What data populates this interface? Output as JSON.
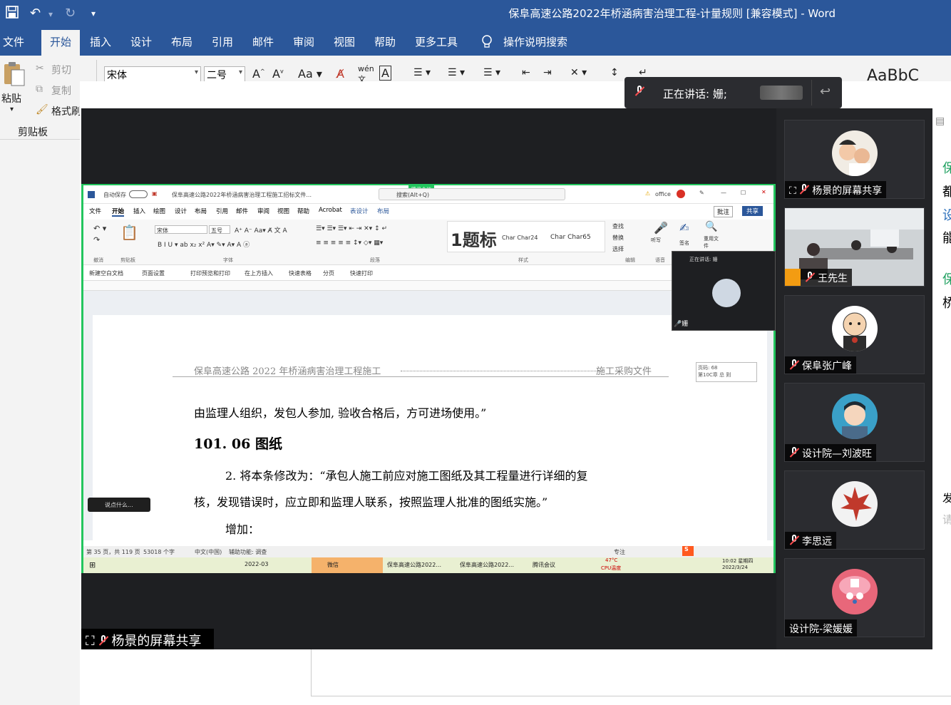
{
  "word": {
    "title": "保阜高速公路2022年桥涵病害治理工程-计量规则 [兼容模式]  -  Word",
    "tabs": [
      "文件",
      "开始",
      "插入",
      "设计",
      "布局",
      "引用",
      "邮件",
      "审阅",
      "视图",
      "帮助",
      "更多工具"
    ],
    "active_tab": "开始",
    "search_label": "操作说明搜索",
    "clipboard": {
      "paste": "粘贴",
      "cut": "剪切",
      "copy": "复制",
      "format_painter": "格式刷",
      "group": "剪贴板"
    },
    "font_name": "宋体",
    "font_size": "二号",
    "style_preview": "AaBbC",
    "right_edge_text": [
      "保",
      "都",
      "设",
      "能",
      "保",
      "桥",
      "发",
      "请"
    ]
  },
  "meeting": {
    "speaking_label": "正在讲话: 姗;",
    "share_label": "杨景的屏幕共享",
    "participants": [
      {
        "name": "杨景的屏幕共享",
        "avatar": "baby-photo-avatar"
      },
      {
        "name": "王先生",
        "avatar": "meeting-room-video"
      },
      {
        "name": "保阜张广峰",
        "avatar": "cartoon-monk-avatar"
      },
      {
        "name": "设计院—刘波旺",
        "avatar": "cartoon-man-avatar"
      },
      {
        "name": "李思远",
        "avatar": "maple-leaf-avatar"
      },
      {
        "name": "设计院-梁媛媛",
        "avatar": "chopper-avatar"
      }
    ]
  },
  "shared": {
    "title": "保阜高速公路2022年桥涵病害治理工程施工招标文件...",
    "autosave": "自动保存",
    "search": "搜索(Alt+Q)",
    "user": "office",
    "share_btn": "共享",
    "annotate_btn": "批注",
    "tabs": [
      "文件",
      "开始",
      "插入",
      "绘图",
      "设计",
      "布局",
      "引用",
      "邮件",
      "审阅",
      "视图",
      "帮助",
      "Acrobat",
      "表设计",
      "布局"
    ],
    "font": "宋体",
    "size": "五号",
    "style_big": "1题标",
    "style2": "Char Char24",
    "style3": "Char Char65",
    "groups": [
      "撤消",
      "剪贴板",
      "字体",
      "段落",
      "样式",
      "编辑",
      "语音"
    ],
    "find": "查找",
    "replace": "替换",
    "select": "选择",
    "listen": "听写",
    "sign": "签名",
    "reuse": "重用文件",
    "quick": [
      "新建空白文档",
      "页面设置",
      "打印预览和打印",
      "在上方插入",
      "快速表格",
      "分页",
      "快速打印"
    ],
    "header_left": "保阜高速公路 2022 年桥涵病害治理工程施工",
    "header_right": "施工采购文件",
    "comment_box": [
      "页码: 68",
      "第10C章 总 则"
    ],
    "line1": "由监理人组织，发包人参加, 验收合格后，方可进场使用。”",
    "heading": "101. 06  图纸",
    "para1": "2. 将本条修改为：“承包人施工前应对施工图纸及其工程量进行详细的复",
    "para2": "核，发现错误时，应立即和监理人联系，按照监理人批准的图纸实施。”",
    "para3": "增加：",
    "status_page": "第 35 页，共 119 页",
    "status_words": "53018 个字",
    "status_lang": "中文(中国)",
    "status_access": "辅助功能: 调查",
    "status_focus": "专注",
    "chat_hint": "说点什么...",
    "meeting_tag": "腾讯会议",
    "float_speaking": "正在讲话: 姗",
    "float_name": "姗",
    "taskbar": [
      "2022-03",
      "微信",
      "保阜高速公路2022...",
      "保阜高速公路2022...",
      "腾讯会议"
    ],
    "tray_temp": "47°C",
    "tray_cpu": "CPU温度",
    "clock_time": "10:02 星期四",
    "clock_date": "2022/3/24"
  }
}
